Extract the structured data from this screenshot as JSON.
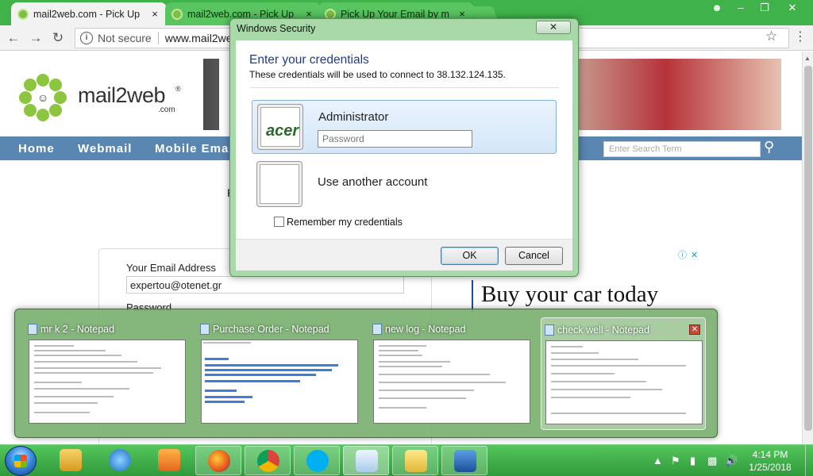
{
  "browser": {
    "tabs": [
      {
        "title": "mail2web.com - Pick Up",
        "active": true
      },
      {
        "title": "mail2web.com - Pick Up",
        "active": false
      },
      {
        "title": "Pick Up Your Email by m",
        "active": false
      }
    ],
    "close_glyph": "×",
    "security_label": "Not secure",
    "url": "www.mail2web.com"
  },
  "site": {
    "logo_word": "mail2web",
    "logo_reg": "®",
    "logo_com": ".com",
    "nav": [
      "Home",
      "Webmail",
      "Mobile Email"
    ],
    "search_placeholder": "Enter Search Term",
    "fragment": "F",
    "email_label": "Your Email Address",
    "email_value": "expertou@otenet.gr",
    "password_label": "Password",
    "ad_title": "Buy your car today",
    "ad_info": "ⓘ",
    "ad_close": "✕"
  },
  "dialog": {
    "title": "Windows Security",
    "heading": "Enter your credentials",
    "subtitle": "These credentials will be used to connect to 38.132.124.135.",
    "account_name": "Administrator",
    "account_logo_text": "acer",
    "password_placeholder": "Password",
    "other_account": "Use another account",
    "remember": "Remember my credentials",
    "ok": "OK",
    "cancel": "Cancel"
  },
  "thumbnails": [
    {
      "title": "mr k 2 - Notepad"
    },
    {
      "title": "Purchase Order - Notepad"
    },
    {
      "title": "new log - Notepad"
    },
    {
      "title": "check well - Notepad"
    }
  ],
  "taskbar": {
    "clock_time": "4:14 PM",
    "clock_date": "1/25/2018"
  },
  "colors": {
    "accent": "#3fb34a",
    "site_nav": "#5a86b2",
    "dialog_heading": "#1e3c8c"
  }
}
